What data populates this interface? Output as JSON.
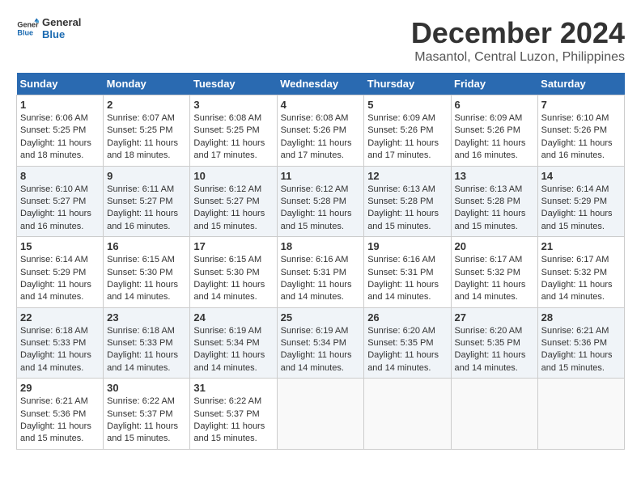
{
  "logo": {
    "text_general": "General",
    "text_blue": "Blue"
  },
  "title": "December 2024",
  "subtitle": "Masantol, Central Luzon, Philippines",
  "days_header": [
    "Sunday",
    "Monday",
    "Tuesday",
    "Wednesday",
    "Thursday",
    "Friday",
    "Saturday"
  ],
  "weeks": [
    [
      {
        "day": "1",
        "sunrise": "Sunrise: 6:06 AM",
        "sunset": "Sunset: 5:25 PM",
        "daylight": "Daylight: 11 hours and 18 minutes."
      },
      {
        "day": "2",
        "sunrise": "Sunrise: 6:07 AM",
        "sunset": "Sunset: 5:25 PM",
        "daylight": "Daylight: 11 hours and 18 minutes."
      },
      {
        "day": "3",
        "sunrise": "Sunrise: 6:08 AM",
        "sunset": "Sunset: 5:25 PM",
        "daylight": "Daylight: 11 hours and 17 minutes."
      },
      {
        "day": "4",
        "sunrise": "Sunrise: 6:08 AM",
        "sunset": "Sunset: 5:26 PM",
        "daylight": "Daylight: 11 hours and 17 minutes."
      },
      {
        "day": "5",
        "sunrise": "Sunrise: 6:09 AM",
        "sunset": "Sunset: 5:26 PM",
        "daylight": "Daylight: 11 hours and 17 minutes."
      },
      {
        "day": "6",
        "sunrise": "Sunrise: 6:09 AM",
        "sunset": "Sunset: 5:26 PM",
        "daylight": "Daylight: 11 hours and 16 minutes."
      },
      {
        "day": "7",
        "sunrise": "Sunrise: 6:10 AM",
        "sunset": "Sunset: 5:26 PM",
        "daylight": "Daylight: 11 hours and 16 minutes."
      }
    ],
    [
      {
        "day": "8",
        "sunrise": "Sunrise: 6:10 AM",
        "sunset": "Sunset: 5:27 PM",
        "daylight": "Daylight: 11 hours and 16 minutes."
      },
      {
        "day": "9",
        "sunrise": "Sunrise: 6:11 AM",
        "sunset": "Sunset: 5:27 PM",
        "daylight": "Daylight: 11 hours and 16 minutes."
      },
      {
        "day": "10",
        "sunrise": "Sunrise: 6:12 AM",
        "sunset": "Sunset: 5:27 PM",
        "daylight": "Daylight: 11 hours and 15 minutes."
      },
      {
        "day": "11",
        "sunrise": "Sunrise: 6:12 AM",
        "sunset": "Sunset: 5:28 PM",
        "daylight": "Daylight: 11 hours and 15 minutes."
      },
      {
        "day": "12",
        "sunrise": "Sunrise: 6:13 AM",
        "sunset": "Sunset: 5:28 PM",
        "daylight": "Daylight: 11 hours and 15 minutes."
      },
      {
        "day": "13",
        "sunrise": "Sunrise: 6:13 AM",
        "sunset": "Sunset: 5:28 PM",
        "daylight": "Daylight: 11 hours and 15 minutes."
      },
      {
        "day": "14",
        "sunrise": "Sunrise: 6:14 AM",
        "sunset": "Sunset: 5:29 PM",
        "daylight": "Daylight: 11 hours and 15 minutes."
      }
    ],
    [
      {
        "day": "15",
        "sunrise": "Sunrise: 6:14 AM",
        "sunset": "Sunset: 5:29 PM",
        "daylight": "Daylight: 11 hours and 14 minutes."
      },
      {
        "day": "16",
        "sunrise": "Sunrise: 6:15 AM",
        "sunset": "Sunset: 5:30 PM",
        "daylight": "Daylight: 11 hours and 14 minutes."
      },
      {
        "day": "17",
        "sunrise": "Sunrise: 6:15 AM",
        "sunset": "Sunset: 5:30 PM",
        "daylight": "Daylight: 11 hours and 14 minutes."
      },
      {
        "day": "18",
        "sunrise": "Sunrise: 6:16 AM",
        "sunset": "Sunset: 5:31 PM",
        "daylight": "Daylight: 11 hours and 14 minutes."
      },
      {
        "day": "19",
        "sunrise": "Sunrise: 6:16 AM",
        "sunset": "Sunset: 5:31 PM",
        "daylight": "Daylight: 11 hours and 14 minutes."
      },
      {
        "day": "20",
        "sunrise": "Sunrise: 6:17 AM",
        "sunset": "Sunset: 5:32 PM",
        "daylight": "Daylight: 11 hours and 14 minutes."
      },
      {
        "day": "21",
        "sunrise": "Sunrise: 6:17 AM",
        "sunset": "Sunset: 5:32 PM",
        "daylight": "Daylight: 11 hours and 14 minutes."
      }
    ],
    [
      {
        "day": "22",
        "sunrise": "Sunrise: 6:18 AM",
        "sunset": "Sunset: 5:33 PM",
        "daylight": "Daylight: 11 hours and 14 minutes."
      },
      {
        "day": "23",
        "sunrise": "Sunrise: 6:18 AM",
        "sunset": "Sunset: 5:33 PM",
        "daylight": "Daylight: 11 hours and 14 minutes."
      },
      {
        "day": "24",
        "sunrise": "Sunrise: 6:19 AM",
        "sunset": "Sunset: 5:34 PM",
        "daylight": "Daylight: 11 hours and 14 minutes."
      },
      {
        "day": "25",
        "sunrise": "Sunrise: 6:19 AM",
        "sunset": "Sunset: 5:34 PM",
        "daylight": "Daylight: 11 hours and 14 minutes."
      },
      {
        "day": "26",
        "sunrise": "Sunrise: 6:20 AM",
        "sunset": "Sunset: 5:35 PM",
        "daylight": "Daylight: 11 hours and 14 minutes."
      },
      {
        "day": "27",
        "sunrise": "Sunrise: 6:20 AM",
        "sunset": "Sunset: 5:35 PM",
        "daylight": "Daylight: 11 hours and 14 minutes."
      },
      {
        "day": "28",
        "sunrise": "Sunrise: 6:21 AM",
        "sunset": "Sunset: 5:36 PM",
        "daylight": "Daylight: 11 hours and 15 minutes."
      }
    ],
    [
      {
        "day": "29",
        "sunrise": "Sunrise: 6:21 AM",
        "sunset": "Sunset: 5:36 PM",
        "daylight": "Daylight: 11 hours and 15 minutes."
      },
      {
        "day": "30",
        "sunrise": "Sunrise: 6:22 AM",
        "sunset": "Sunset: 5:37 PM",
        "daylight": "Daylight: 11 hours and 15 minutes."
      },
      {
        "day": "31",
        "sunrise": "Sunrise: 6:22 AM",
        "sunset": "Sunset: 5:37 PM",
        "daylight": "Daylight: 11 hours and 15 minutes."
      },
      null,
      null,
      null,
      null
    ]
  ]
}
